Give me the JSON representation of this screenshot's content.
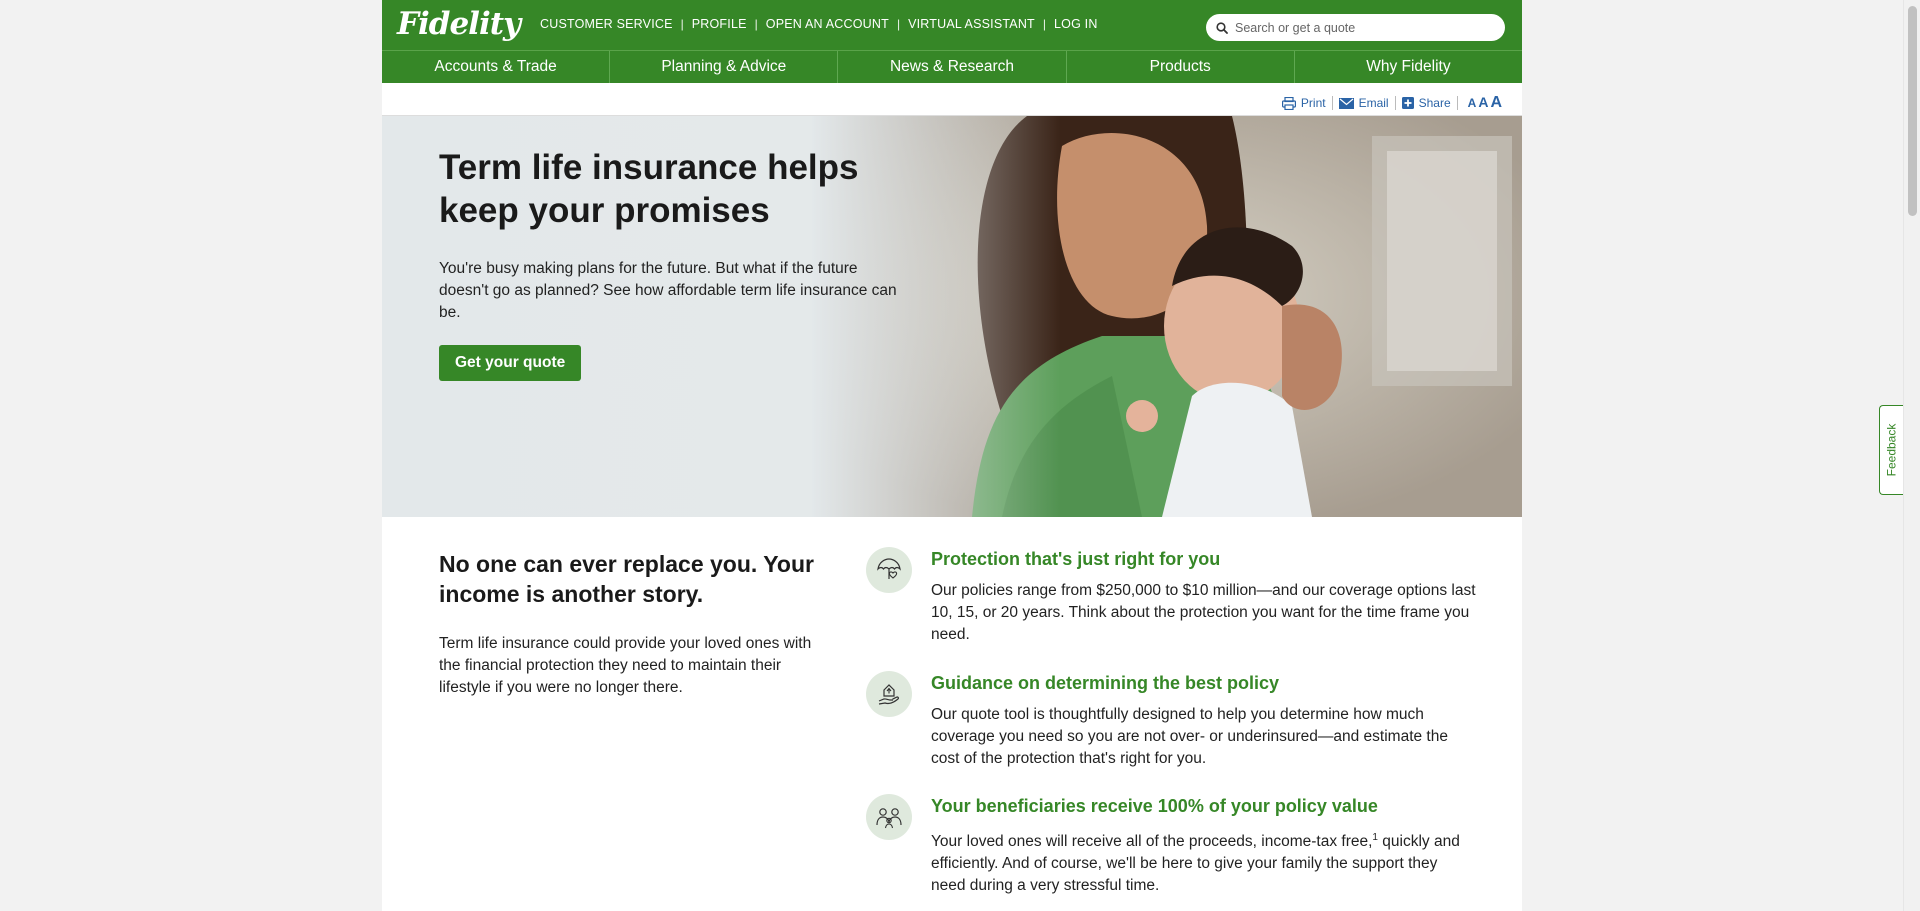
{
  "header": {
    "logo": "Fidelity",
    "utility_links": [
      "CUSTOMER SERVICE",
      "PROFILE",
      "OPEN AN ACCOUNT",
      "VIRTUAL ASSISTANT",
      "LOG IN"
    ],
    "search_placeholder": "Search or get a quote"
  },
  "nav": {
    "items": [
      "Accounts & Trade",
      "Planning & Advice",
      "News & Research",
      "Products",
      "Why Fidelity"
    ]
  },
  "tools": {
    "print": "Print",
    "email": "Email",
    "share": "Share",
    "text_sizes": [
      "A",
      "A",
      "A"
    ]
  },
  "hero": {
    "title": "Term life insurance helps keep your promises",
    "text": "You're busy making plans for the future. But what if the future doesn't go as planned? See how affordable term life insurance can be.",
    "button": "Get your quote"
  },
  "intro": {
    "title": "No one can ever replace you. Your income is another story.",
    "text": "Term life insurance could provide your loved ones with the financial protection they need to maintain their lifestyle if you were no longer there."
  },
  "features": [
    {
      "icon": "umbrella-heart-icon",
      "title": "Protection that's just right for you",
      "text": "Our policies range from $250,000 to $10 million—and our coverage options last 10, 15, or 20 years. Think about the protection you want for the time frame you need."
    },
    {
      "icon": "hand-house-icon",
      "title": "Guidance on determining the best policy",
      "text": "Our quote tool is thoughtfully designed to help you determine how much coverage you need so you are not over- or underinsured—and estimate the cost of the protection that's right for you."
    },
    {
      "icon": "family-icon",
      "title": "Your beneficiaries receive 100% of your policy value",
      "text_before": "Your loved ones will receive all of the proceeds, income-tax free,",
      "footnote": "1",
      "text_after": " quickly and efficiently. And of course, we'll be here to give your family the support they need during a very stressful time."
    }
  ],
  "feedback": "Feedback",
  "colors": {
    "brand_green": "#368727",
    "link_blue": "#2a63a6"
  }
}
